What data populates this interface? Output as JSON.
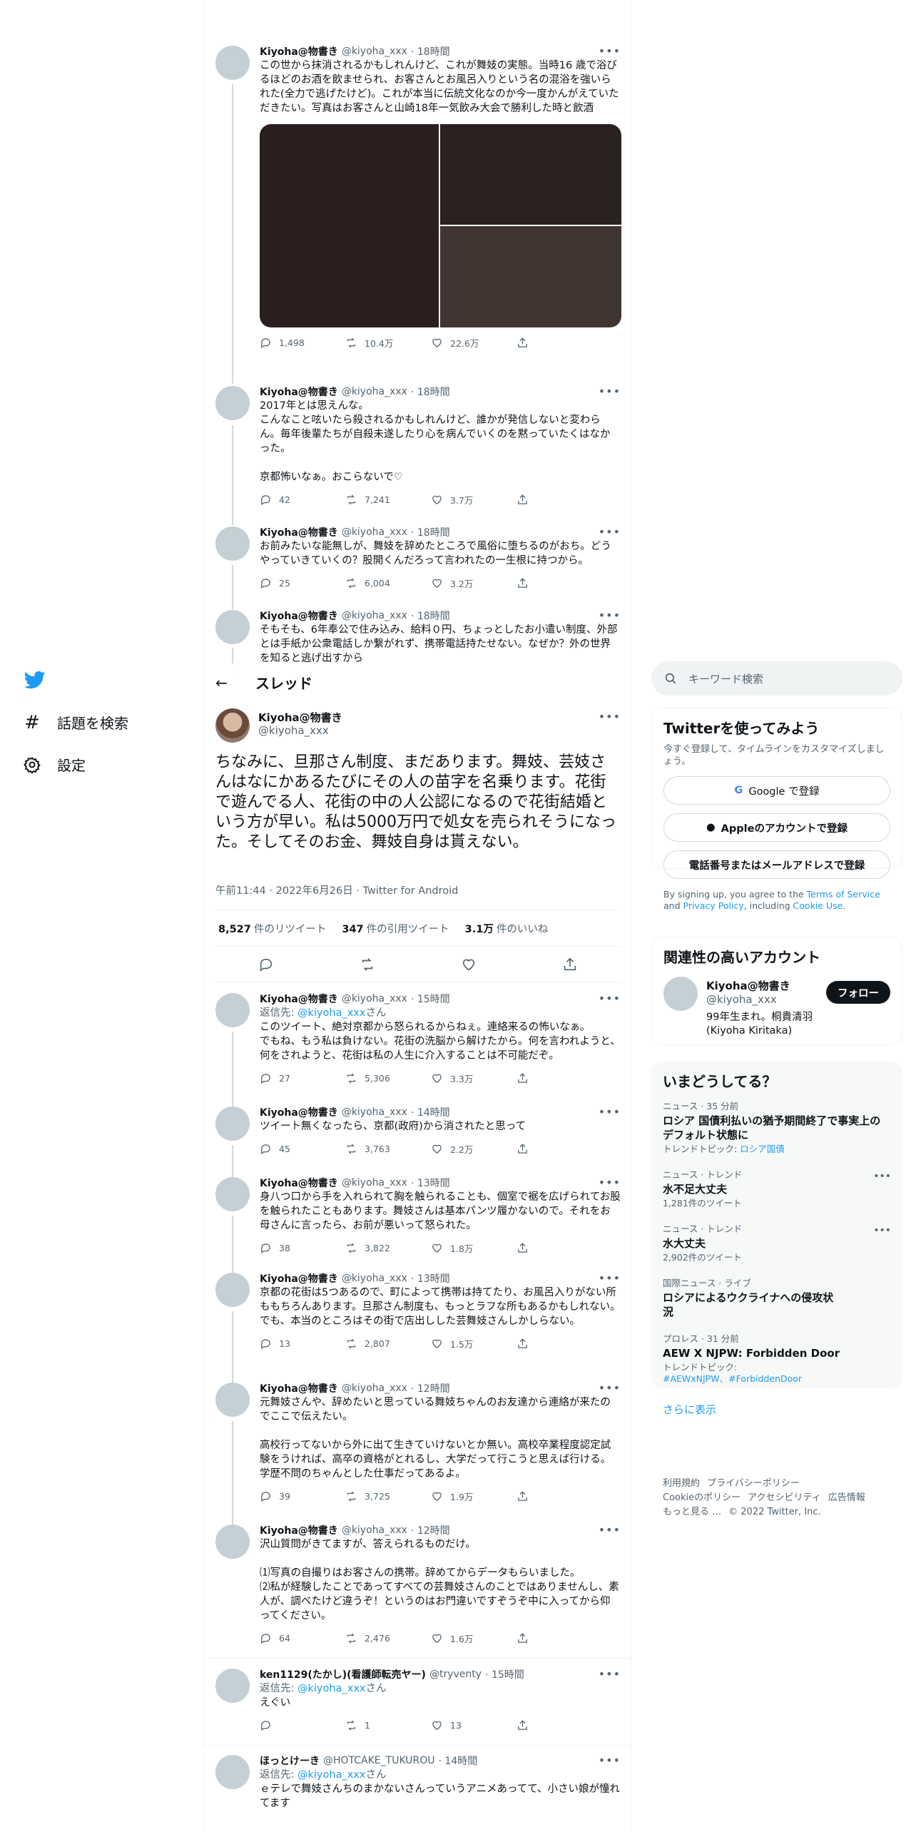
{
  "nav": {
    "explore_label": "話題を検索",
    "settings_label": "設定"
  },
  "header": {
    "back": "←",
    "title": "スレッド"
  },
  "upper_tweets": [
    {
      "name": "Kiyoha@物書き",
      "handle": "@kiyoha_xxx",
      "time": "· 18時間",
      "text": "この世から抹消されるかもしれんけど、これが舞妓の実態。当時16 歳で浴びるほどのお酒を飲ませられ、お客さんとお風呂入りという名の混浴を強いられた(全力で逃げたけど)。これが本当に伝統文化なのか今一度かんがえていただきたい。写真はお客さんと山崎18年一気飲み大会で勝利した時と飲酒",
      "replies": "1,498",
      "retweets": "10.4万",
      "likes": "22.6万"
    },
    {
      "name": "Kiyoha@物書き",
      "handle": "@kiyoha_xxx",
      "time": "· 18時間",
      "text": "2017年とは思えんな。\nこんなこと呟いたら殺されるかもしれんけど、誰かが発信しないと変わらん。毎年後輩たちが自殺未遂したり心を病んでいくのを黙っていたくはなかった。\n\n京都怖いなぁ。おこらないで♡",
      "replies": "42",
      "retweets": "7,241",
      "likes": "3.7万"
    },
    {
      "name": "Kiyoha@物書き",
      "handle": "@kiyoha_xxx",
      "time": "· 18時間",
      "text": "お前みたいな能無しが、舞妓を辞めたところで風俗に堕ちるのがおち。どうやっていきていくの？股開くんだろって言われたの一生根に持つから。",
      "replies": "25",
      "retweets": "6,004",
      "likes": "3.2万"
    },
    {
      "name": "Kiyoha@物書き",
      "handle": "@kiyoha_xxx",
      "time": "· 18時間",
      "text": "そもそも、6年奉公で住み込み、給料０円、ちょっとしたお小遣い制度、外部とは手紙か公衆電話しか繋がれず、携帯電話持たせない。なぜか？外の世界を知ると逃げ出すから"
    }
  ],
  "main_tweet": {
    "name": "Kiyoha@物書き",
    "handle": "@kiyoha_xxx",
    "text": "ちなみに、旦那さん制度、まだあります。舞妓、芸妓さんはなにかあるたびにその人の苗字を名乗ります。花街で遊んでる人、花街の中の人公認になるので花街結婚という方が早い。私は5000万円で処女を売られそうになった。そしてそのお金、舞妓自身は貰えない。",
    "meta": "午前11:44 · 2022年6月26日 · Twitter for Android",
    "retweets_num": "8,527",
    "retweets_label": "件のリツイート",
    "quotes_num": "347",
    "quotes_label": "件の引用ツイート",
    "likes_num": "3.1万",
    "likes_label": "件のいいね"
  },
  "replies": [
    {
      "name": "Kiyoha@物書き",
      "handle": "@kiyoha_xxx",
      "time": "· 15時間",
      "reply_to_prefix": "返信先: ",
      "reply_to": "@kiyoha_xxx",
      "reply_to_suffix": "さん",
      "text": "このツイート、絶対京都から怒られるからねぇ。連絡来るの怖いなぁ。\nでもね、もう私は負けない。花街の洗脳から解けたから。何を言われようと、何をされようと、花街は私の人生に介入することは不可能だぞ。",
      "replies": "27",
      "retweets": "5,306",
      "likes": "3.3万"
    },
    {
      "name": "Kiyoha@物書き",
      "handle": "@kiyoha_xxx",
      "time": "· 14時間",
      "text": "ツイート無くなったら、京都(政府)から消されたと思って",
      "replies": "45",
      "retweets": "3,763",
      "likes": "2.2万"
    },
    {
      "name": "Kiyoha@物書き",
      "handle": "@kiyoha_xxx",
      "time": "· 13時間",
      "text": "身八つ口から手を入れられて胸を触られることも、個室で裾を広げられてお股を触られたこともあります。舞妓さんは基本パンツ履かないので。それをお母さんに言ったら、お前が悪いって怒られた。",
      "replies": "38",
      "retweets": "3,822",
      "likes": "1.8万"
    },
    {
      "name": "Kiyoha@物書き",
      "handle": "@kiyoha_xxx",
      "time": "· 13時間",
      "text": "京都の花街は5つあるので、町によって携帯は持てたり、お風呂入りがない所ももちろんあります。旦那さん制度も、もっとラフな所もあるかもしれない。でも、本当のところはその街で店出しした芸舞妓さんしかしらない。",
      "replies": "13",
      "retweets": "2,807",
      "likes": "1.5万"
    },
    {
      "name": "Kiyoha@物書き",
      "handle": "@kiyoha_xxx",
      "time": "· 12時間",
      "text": "元舞妓さんや、辞めたいと思っている舞妓ちゃんのお友達から連絡が来たのでここで伝えたい。\n\n高校行ってないから外に出て生きていけないとか無い。高校卒業程度認定試験をうければ、高卒の資格がとれるし、大学だって行こうと思えば行ける。学歴不問のちゃんとした仕事だってあるよ。",
      "replies": "39",
      "retweets": "3,725",
      "likes": "1.9万"
    },
    {
      "name": "Kiyoha@物書き",
      "handle": "@kiyoha_xxx",
      "time": "· 12時間",
      "text": "沢山質問がきてますが、答えられるものだけ。\n\n⑴写真の自撮りはお客さんの携帯。辞めてからデータもらいました。\n⑵私が経験したことであってすべての芸舞妓さんのことではありませんし、素人が、調べたけど違うぞ！というのはお門違いですぞうぞ中に入ってから仰ってください。",
      "replies": "64",
      "retweets": "2,476",
      "likes": "1.6万"
    },
    {
      "name": "ken1129(たかし)(看護師転売ヤー)",
      "handle": "@tryventy",
      "time": "· 15時間",
      "reply_to_prefix": "返信先: ",
      "reply_to": "@kiyoha_xxx",
      "reply_to_suffix": "さん",
      "text": "えぐい",
      "replies": "",
      "retweets": "1",
      "likes": "13"
    },
    {
      "name": "ほっとけーき",
      "handle": "@HOTCAKE_TUKUROU",
      "time": "· 14時間",
      "reply_to_prefix": "返信先: ",
      "reply_to": "@kiyoha_xxx",
      "reply_to_suffix": "さん",
      "text": "ｅテレで舞妓さんちのまかないさんっていうアニメあってて、小さい娘が憧れてます"
    }
  ],
  "right": {
    "search_placeholder": "キーワード検索",
    "signup": {
      "title": "Twitterを使ってみよう",
      "sub": "今すぐ登録して、タイムラインをカスタマイズしましょう。",
      "google": "Google で登録",
      "apple": "Appleのアカウントで登録",
      "phone": "電話番号またはメールアドレスで登録",
      "terms_1": "By signing up, you agree to the ",
      "terms_link1": "Terms of Service",
      "terms_2": " and ",
      "terms_link2": "Privacy Policy",
      "terms_3": ", including ",
      "terms_link3": "Cookie Use",
      "terms_4": "."
    },
    "related": {
      "title": "関連性の高いアカウント",
      "name": "Kiyoha@物書き",
      "handle": "@kiyoha_xxx",
      "bio": "99年生まれ。桐貴清羽(Kiyoha Kiritaka)",
      "follow": "フォロー"
    },
    "trends": {
      "title": "いまどうしてる？",
      "items": [
        {
          "ctx": "ニュース · 35 分前",
          "name": "ロシア 国債利払いの猶予期間終了で事実上のデフォルト状態に",
          "cnt_prefix": "トレンドトピック: ",
          "cnt_link": "ロシア国債"
        },
        {
          "ctx": "ニュース · トレンド",
          "name": "水不足大丈夫",
          "cnt": "1,281件のツイート"
        },
        {
          "ctx": "ニュース · トレンド",
          "name": "水大丈夫",
          "cnt": "2,902件のツイート"
        },
        {
          "ctx": "国際ニュース · ライブ",
          "name": "ロシアによるウクライナへの侵攻状況"
        },
        {
          "ctx": "プロレス · 31 分前",
          "name": "AEW X NJPW: Forbidden Door",
          "cnt_prefix": "トレンドトピック:",
          "cnt_link": "#AEWxNJPW、#ForbiddenDoor"
        }
      ],
      "more": "さらに表示"
    },
    "footer": {
      "l1a": "利用規約",
      "l1b": "プライバシーポリシー",
      "l2a": "Cookieのポリシー",
      "l2b": "アクセシビリティ",
      "l2c": "広告情報",
      "l3a": "もっと見る …",
      "l3b": "© 2022 Twitter, Inc."
    }
  }
}
